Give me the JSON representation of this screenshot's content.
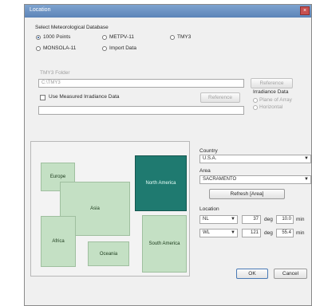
{
  "window": {
    "title": "Location",
    "close_glyph": "×"
  },
  "database": {
    "label": "Select Meteorological Database",
    "options": [
      {
        "label": "1000 Points",
        "selected": true
      },
      {
        "label": "METPV-11",
        "selected": false
      },
      {
        "label": "TMY3",
        "selected": false
      },
      {
        "label": "MONSOLA-11",
        "selected": false
      },
      {
        "label": "Import Data",
        "selected": false
      }
    ]
  },
  "tmy3": {
    "label": "TMY3 Folder",
    "value": "C:\\TMY3",
    "reference_label": "Reference"
  },
  "measured": {
    "checkbox_label": "Use Measured Irradiance Data",
    "reference_label": "Reference",
    "value": ""
  },
  "irradiance": {
    "label": "Irradiance Data",
    "options": [
      {
        "label": "Plane of Array",
        "selected": true
      },
      {
        "label": "Horizontal",
        "selected": false
      }
    ]
  },
  "continents": {
    "europe": "Europe",
    "asia": "Asia",
    "africa": "Africa",
    "oceania": "Oceania",
    "north_america": "North America",
    "south_america": "South America",
    "selected": "North America"
  },
  "country": {
    "label": "Country",
    "value": "U.S.A."
  },
  "area": {
    "label": "Area",
    "value": "SACRAMENTO"
  },
  "refresh_label": "Refresh [Area]",
  "location": {
    "label": "Location",
    "lat_dir": "NL",
    "lat_deg": "37",
    "lat_min": "10.0",
    "lon_dir": "WL",
    "lon_deg": "121",
    "lon_min": "55.4",
    "deg_unit": "deg",
    "min_unit": "min"
  },
  "footer": {
    "ok_label": "OK",
    "cancel_label": "Cancel"
  },
  "colors": {
    "titlebar": "#6a90c2",
    "selected_continent": "#1f7a70",
    "continent": "#c4e0c4"
  }
}
